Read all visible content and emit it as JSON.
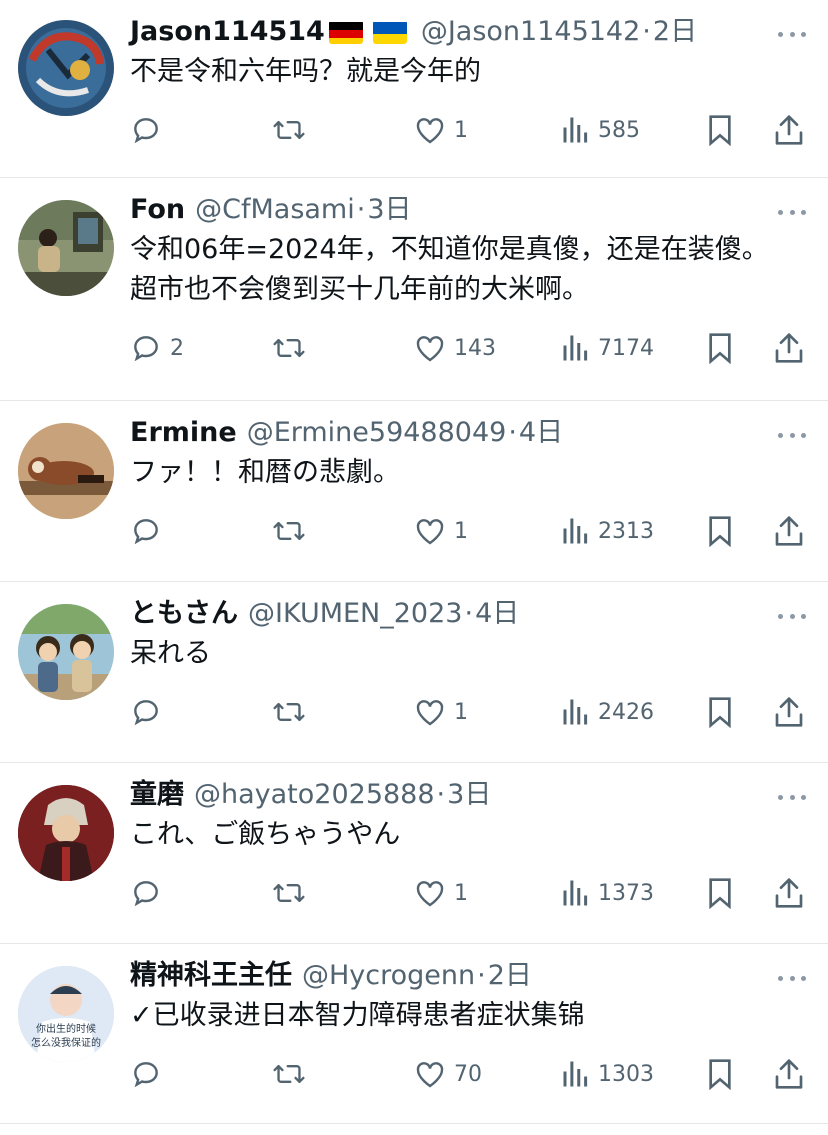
{
  "tweets": [
    {
      "name": "Jason114514",
      "flags": [
        "germany-flag",
        "ukraine-flag"
      ],
      "handle": "@Jason1145142",
      "separator": "·",
      "time": "2日",
      "text": "不是令和六年吗？就是今年的",
      "reply_count": "",
      "like_count": "1",
      "view_count": "585",
      "avatar_colors": [
        "#3a6d9a",
        "#c0392b",
        "#1b2a3a"
      ]
    },
    {
      "name": "Fon",
      "handle": "@CfMasami",
      "separator": "·",
      "time": "3日",
      "text": "令和06年=2024年，不知道你是真傻，还是在装傻。超市也不会傻到买十几年前的大米啊。",
      "reply_count": "2",
      "like_count": "143",
      "view_count": "7174",
      "avatar_colors": [
        "#6e7a5c",
        "#c9b48a",
        "#3b4030"
      ]
    },
    {
      "name": "Ermine",
      "handle": "@Ermine59488049",
      "separator": "·",
      "time": "4日",
      "text": "ファ！！和暦の悲劇。",
      "reply_count": "",
      "like_count": "1",
      "view_count": "2313",
      "avatar_colors": [
        "#c8a27a",
        "#8a4b2a",
        "#f1e2cc"
      ]
    },
    {
      "name": "ともさん",
      "handle": "@IKUMEN_2023",
      "separator": "·",
      "time": "4日",
      "text": "呆れる",
      "reply_count": "",
      "like_count": "1",
      "view_count": "2426",
      "avatar_colors": [
        "#7fa86a",
        "#d9c39a",
        "#4e6a8a"
      ]
    },
    {
      "name": "童磨",
      "handle": "@hayato2025888",
      "separator": "·",
      "time": "3日",
      "text": "これ、ご飯ちゃうやん",
      "reply_count": "",
      "like_count": "1",
      "view_count": "1373",
      "avatar_colors": [
        "#a52a2a",
        "#e8c9a8",
        "#3a1a1a"
      ]
    },
    {
      "name": "精神科王主任",
      "handle": "@Hycrogenn",
      "separator": "·",
      "time": "2日",
      "text": "✓已收录进日本智力障碍患者症状集锦",
      "reply_count": "",
      "like_count": "70",
      "view_count": "1303",
      "avatar_colors": [
        "#dfe9f5",
        "#f3d6c4",
        "#2c3e50"
      ],
      "avatar_caption": [
        "你出生的时候",
        "怎么没我保证的"
      ]
    }
  ]
}
